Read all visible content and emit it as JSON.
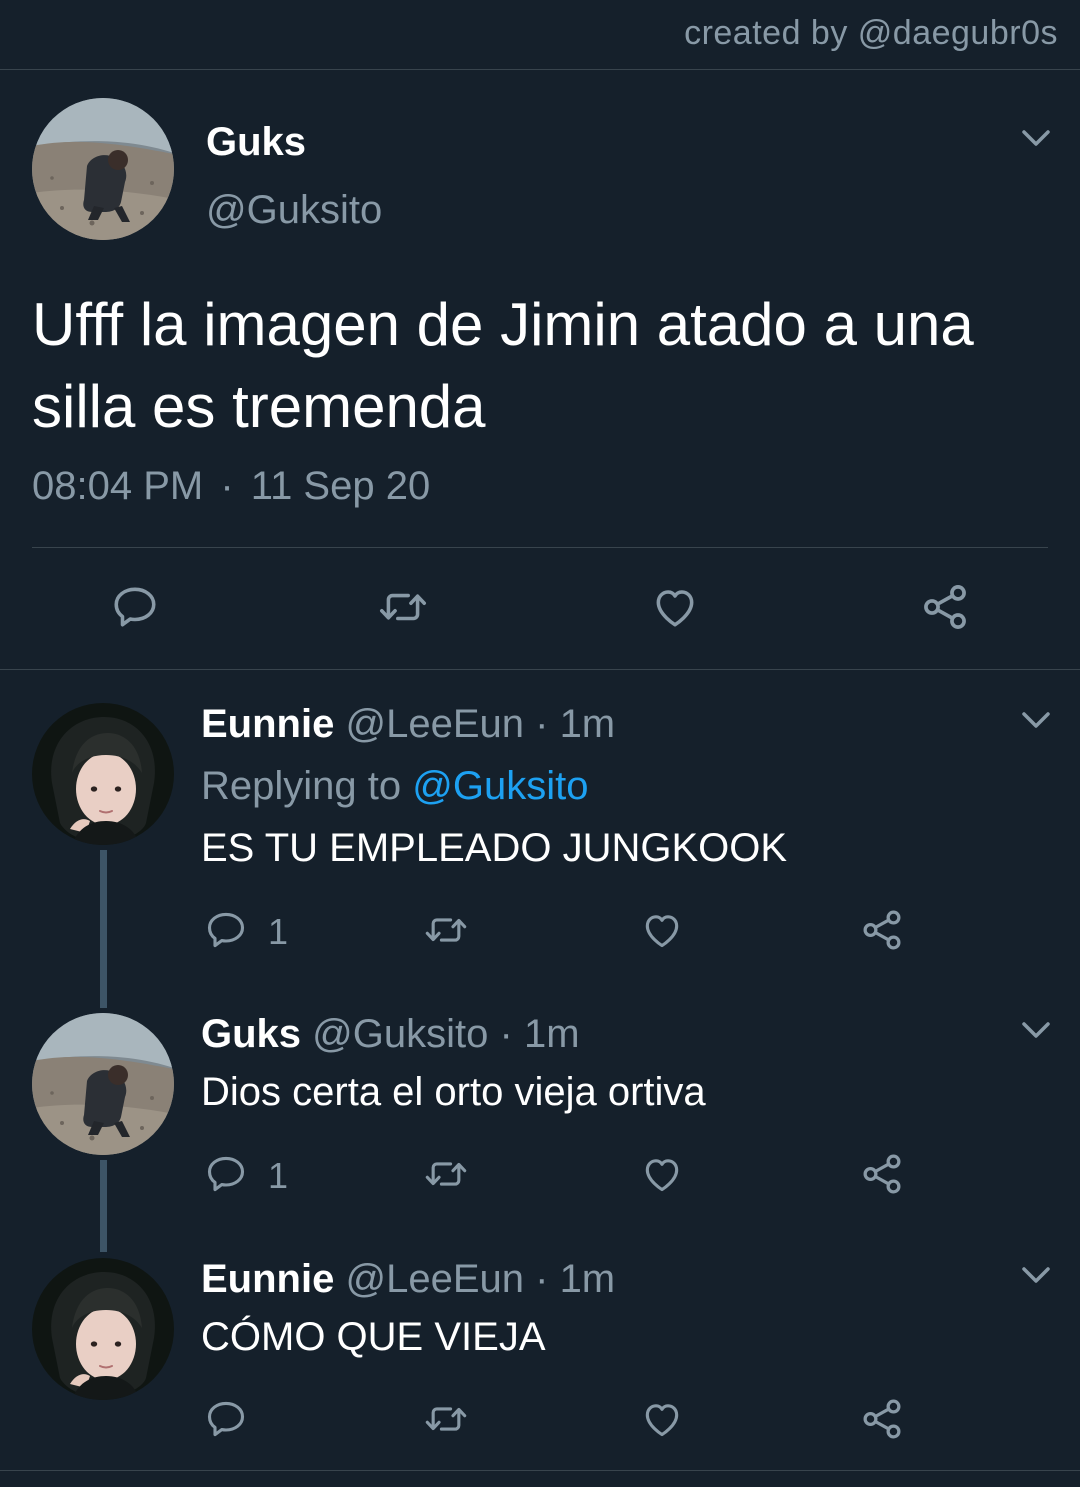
{
  "credit": "created by @daegubr0s",
  "main_tweet": {
    "name": "Guks",
    "handle": "@Guksito",
    "text": "Ufff la imagen de Jimin atado a una silla es tremenda",
    "time": "08:04 PM",
    "separator": "·",
    "date": "11 Sep 20",
    "avatar": "avatar-guks",
    "actions": [
      "reply-icon",
      "retweet-icon",
      "like-icon",
      "share-icon"
    ]
  },
  "replies": [
    {
      "name": "Eunnie",
      "handle": "@LeeEun",
      "separator": "·",
      "time": "1m",
      "replying_prefix": "Replying to ",
      "replying_to": "@Guksito",
      "text": "ES TU EMPLEADO JUNGKOOK",
      "reply_count": "1",
      "avatar": "avatar-eunnie"
    },
    {
      "name": "Guks",
      "handle": "@Guksito",
      "separator": "·",
      "time": "1m",
      "text": "Dios certa el orto vieja ortiva",
      "reply_count": "1",
      "avatar": "avatar-guks"
    },
    {
      "name": "Eunnie",
      "handle": "@LeeEun",
      "separator": "·",
      "time": "1m",
      "text": "CÓMO QUE VIEJA",
      "reply_count": "",
      "avatar": "avatar-eunnie"
    }
  ],
  "colors": {
    "background": "#15202b",
    "secondary_text": "#8899a6",
    "link": "#1da1f2",
    "divider": "#38444d",
    "thread_line": "#3d5466"
  }
}
